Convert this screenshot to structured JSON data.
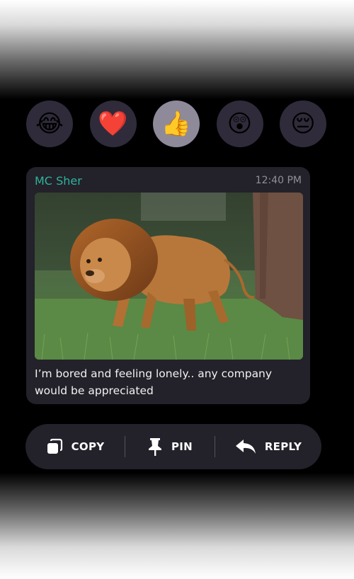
{
  "reactions": [
    {
      "emoji": "😂",
      "name": "tears-of-joy",
      "selected": false
    },
    {
      "emoji": "❤️",
      "name": "heart",
      "selected": false
    },
    {
      "emoji": "👍",
      "name": "thumbs-up",
      "selected": true
    },
    {
      "emoji": "😲",
      "name": "astonished",
      "selected": false
    },
    {
      "emoji": "😔",
      "name": "pensive",
      "selected": false
    }
  ],
  "message": {
    "sender": "MC Sher",
    "time": "12:40 PM",
    "text": "I’m bored and feeling lonely.. any company would be appreciated",
    "image_icon": "lion-photo"
  },
  "actions": {
    "copy_label": "COPY",
    "pin_label": "PIN",
    "reply_label": "REPLY"
  },
  "colors": {
    "accent": "#2fb39a",
    "bubble": "#23212a",
    "reaction_bg": "#2f2b3a",
    "reaction_selected_bg": "#8e8a99"
  }
}
